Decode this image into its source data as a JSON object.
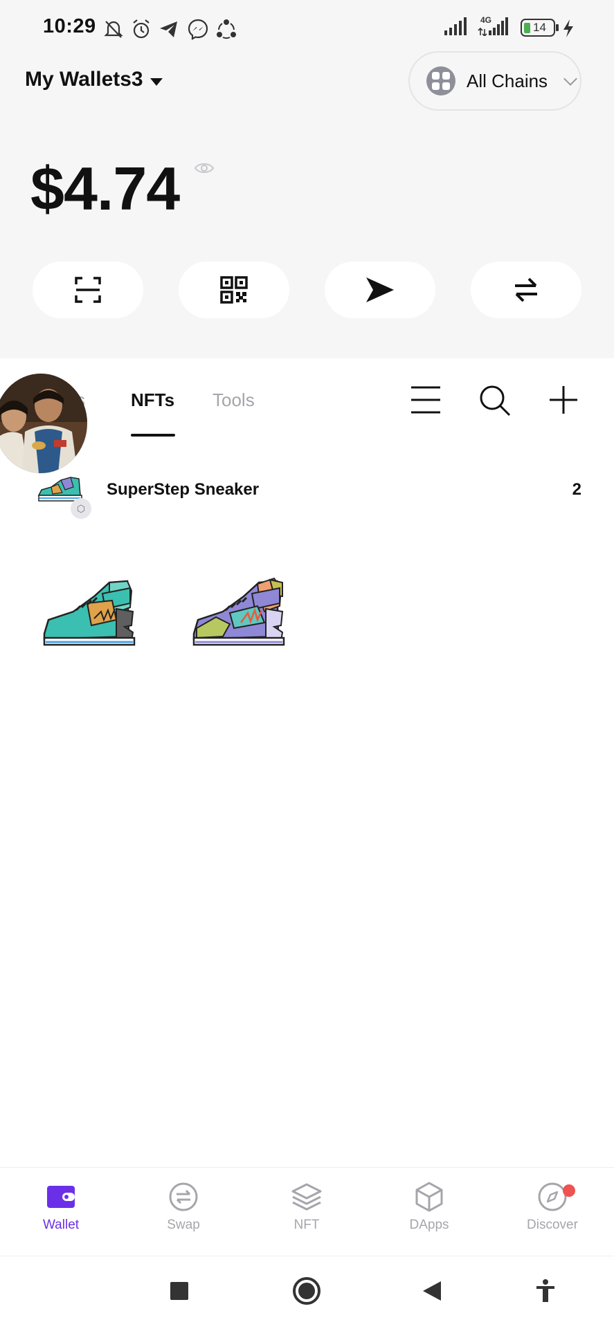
{
  "status_bar": {
    "time": "10:29",
    "network_label": "4G",
    "battery": "14"
  },
  "header": {
    "wallet_name": "My Wallets3",
    "chain_selector": "All Chains"
  },
  "balance": {
    "amount": "$4.74"
  },
  "actions": [
    {
      "icon": "scan-icon"
    },
    {
      "icon": "qr-code-icon"
    },
    {
      "icon": "send-icon"
    },
    {
      "icon": "swap-arrows-icon"
    }
  ],
  "tabs": {
    "items": [
      {
        "label": "Tokens",
        "visible_label": "s"
      },
      {
        "label": "NFTs"
      },
      {
        "label": "Tools"
      }
    ],
    "active": "NFTs"
  },
  "collection": {
    "name": "SuperStep Sneaker",
    "count": "2"
  },
  "bottom_nav": {
    "items": [
      {
        "label": "Wallet",
        "icon": "wallet-icon",
        "active": true
      },
      {
        "label": "Swap",
        "icon": "swap-icon"
      },
      {
        "label": "NFT",
        "icon": "layers-icon"
      },
      {
        "label": "DApps",
        "icon": "cube-icon"
      },
      {
        "label": "Discover",
        "icon": "compass-icon",
        "has_badge": true
      }
    ]
  },
  "colors": {
    "accent": "#6b2fe8",
    "badge": "#ef5350",
    "header_bg": "#f6f6f7"
  }
}
